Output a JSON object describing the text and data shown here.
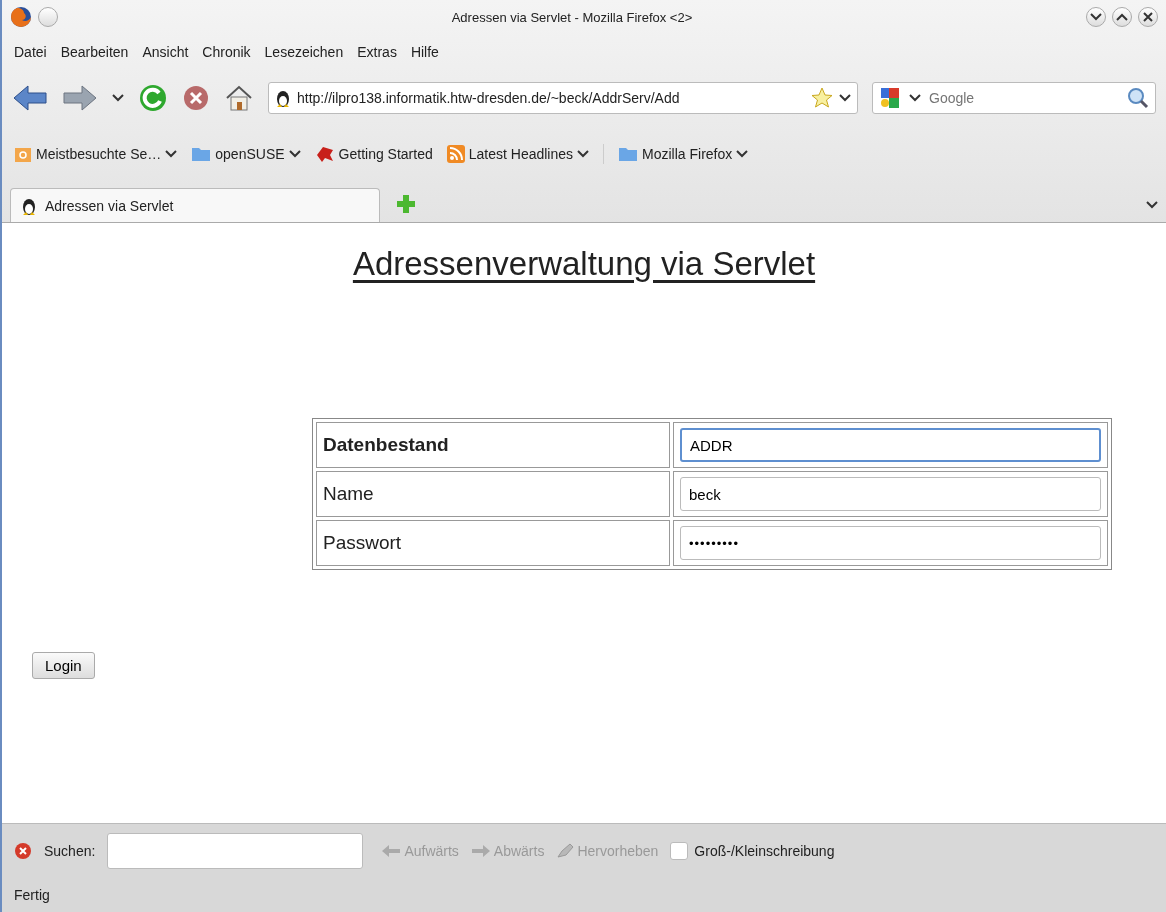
{
  "window": {
    "title": "Adressen via Servlet - Mozilla Firefox <2>"
  },
  "menu": [
    "Datei",
    "Bearbeiten",
    "Ansicht",
    "Chronik",
    "Lesezeichen",
    "Extras",
    "Hilfe"
  ],
  "address_bar": {
    "value": "http://ilpro138.informatik.htw-dresden.de/~beck/AddrServ/Add"
  },
  "search": {
    "placeholder": "Google"
  },
  "bookmarks": [
    {
      "label": "Meistbesuchte Se…",
      "kind": "smart",
      "dropdown": true
    },
    {
      "label": "openSUSE",
      "kind": "folder",
      "dropdown": true
    },
    {
      "label": "Getting Started",
      "kind": "page",
      "dropdown": false
    },
    {
      "label": "Latest Headlines",
      "kind": "feed",
      "dropdown": true
    },
    {
      "label": "Mozilla Firefox",
      "kind": "folder",
      "dropdown": true
    }
  ],
  "tabs": [
    {
      "label": "Adressen via Servlet",
      "selected": true
    }
  ],
  "page": {
    "heading": "Adressenverwaltung via Servlet",
    "form_rows": [
      {
        "label": "Datenbestand",
        "value": "ADDR",
        "bold": true,
        "focused": true,
        "kind": "text"
      },
      {
        "label": "Name",
        "value": "beck",
        "bold": false,
        "focused": false,
        "kind": "text"
      },
      {
        "label": "Passwort",
        "value": "•••••••••",
        "bold": false,
        "focused": false,
        "kind": "password"
      }
    ],
    "button": "Login"
  },
  "find_bar": {
    "label": "Suchen:",
    "buttons": [
      "Aufwärts",
      "Abwärts",
      "Hervorheben"
    ],
    "checkbox": {
      "label": "Groß-/Kleinschreibung",
      "checked": false
    }
  },
  "status_bar": "Fertig"
}
